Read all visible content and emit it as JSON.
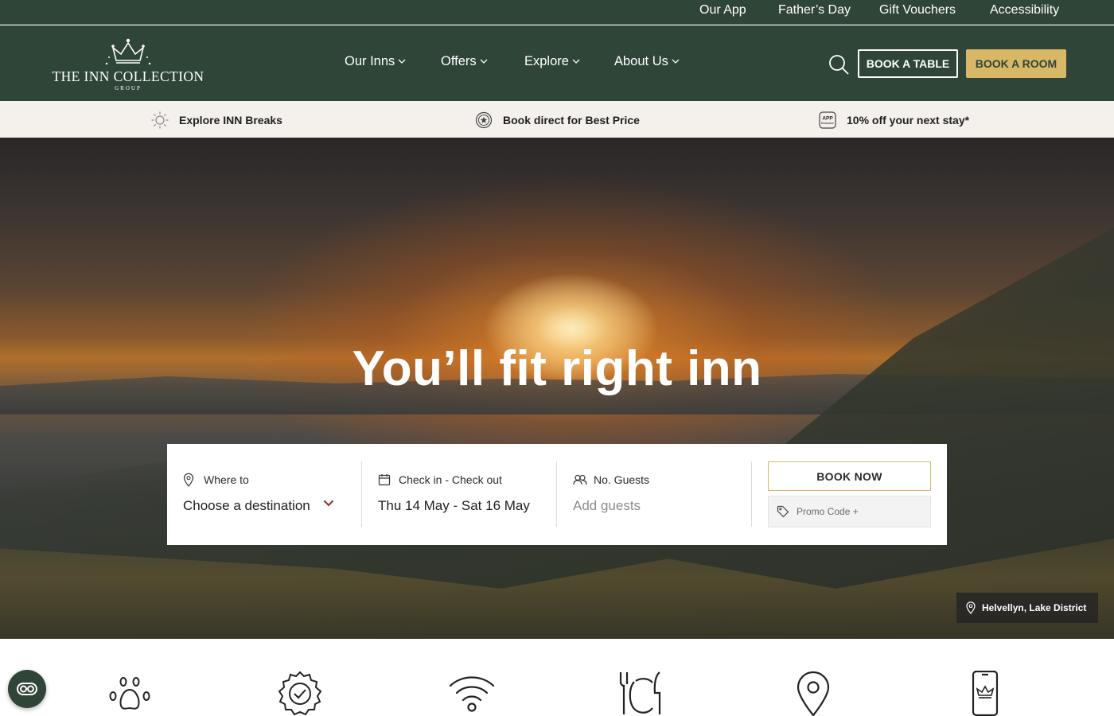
{
  "topbar": {
    "links": [
      "Our App",
      "Father’s Day",
      "Gift Vouchers",
      "Accessibility"
    ]
  },
  "header": {
    "logo": {
      "name": "THE INN COLLECTION",
      "sub": "GROUP"
    },
    "nav": [
      "Our Inns",
      "Offers",
      "Explore",
      "About Us"
    ],
    "book_table": "BOOK A TABLE",
    "book_room": "BOOK A ROOM"
  },
  "benefits": [
    {
      "label": "Explore INN Breaks",
      "icon": "sun-icon"
    },
    {
      "label": "Book direct for Best Price",
      "icon": "star-badge-icon"
    },
    {
      "label": "10% off your next stay*",
      "icon": "app-icon"
    }
  ],
  "app_icon_text": {
    "top": "APP",
    "bottom": "Exclusive"
  },
  "hero": {
    "title": "You’ll fit right inn",
    "location": "Helvellyn, Lake District"
  },
  "booking": {
    "where": {
      "label": "Where to",
      "value": "Choose a destination"
    },
    "dates": {
      "label": "Check in - Check out",
      "value": "Thu 14 May - Sat 16 May"
    },
    "guests": {
      "label": "No. Guests",
      "placeholder": "Add guests"
    },
    "book_now": "BOOK NOW",
    "promo": "Promo Code +"
  },
  "features": [
    "paw-icon",
    "verified-badge-icon",
    "wifi-icon",
    "dining-icon",
    "location-pin-icon",
    "mobile-app-icon"
  ],
  "colors": {
    "brand_green": "#2f4538",
    "gold": "#d8b766",
    "strip_bg": "#f4f1ec",
    "accent_red": "#8b2c2c"
  }
}
